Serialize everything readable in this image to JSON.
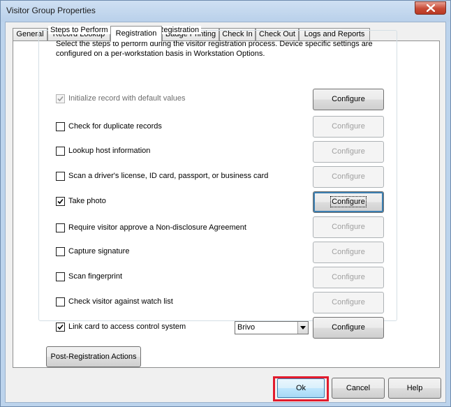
{
  "window": {
    "title": "Visitor Group Properties"
  },
  "tabs": [
    {
      "label": "General",
      "active": false
    },
    {
      "label": "Record Lookup",
      "active": false
    },
    {
      "label": "Registration",
      "active": true
    },
    {
      "label": "Badge Printing",
      "active": false
    },
    {
      "label": "Check In",
      "active": false
    },
    {
      "label": "Check Out",
      "active": false
    },
    {
      "label": "Logs and Reports",
      "active": false
    }
  ],
  "group": {
    "label": "Steps to Perform During Visitor Registration",
    "description": "Select the steps to perform during the visitor registration process. Device specific settings are configured on a per-workstation basis in Workstation Options."
  },
  "steps": [
    {
      "label": "Initialize record with default values",
      "checked": true,
      "disabled": true,
      "configure_label": "Configure",
      "configure_enabled": true
    },
    {
      "label": "Check for duplicate records",
      "checked": false,
      "disabled": false,
      "configure_label": "Configure",
      "configure_enabled": false
    },
    {
      "label": "Lookup host information",
      "checked": false,
      "disabled": false,
      "configure_label": "Configure",
      "configure_enabled": false
    },
    {
      "label": "Scan a driver's license, ID card, passport, or business card",
      "checked": false,
      "disabled": false,
      "configure_label": "Configure",
      "configure_enabled": false
    },
    {
      "label": "Take photo",
      "checked": true,
      "disabled": false,
      "configure_label": "Configure",
      "configure_enabled": true
    },
    {
      "label": "Require visitor approve a Non-disclosure Agreement",
      "checked": false,
      "disabled": false,
      "configure_label": "Configure",
      "configure_enabled": false
    },
    {
      "label": "Capture signature",
      "checked": false,
      "disabled": false,
      "configure_label": "Configure",
      "configure_enabled": false
    },
    {
      "label": "Scan fingerprint",
      "checked": false,
      "disabled": false,
      "configure_label": "Configure",
      "configure_enabled": false
    },
    {
      "label": "Check visitor against watch list",
      "checked": false,
      "disabled": false,
      "configure_label": "Configure",
      "configure_enabled": false
    },
    {
      "label": "Link card to access control system",
      "checked": true,
      "disabled": false,
      "configure_label": "Configure",
      "configure_enabled": true
    }
  ],
  "access_control_select": {
    "value": "Brivo"
  },
  "post_registration_button": "Post-Registration Actions",
  "dialog_buttons": {
    "ok": "Ok",
    "cancel": "Cancel",
    "help": "Help"
  },
  "colors": {
    "highlight": "#e21b2d",
    "window_frame": "#bcd3ec"
  },
  "icons": {
    "close": "close-icon",
    "check": "checkmark-icon",
    "dropdown": "chevron-down-icon"
  }
}
